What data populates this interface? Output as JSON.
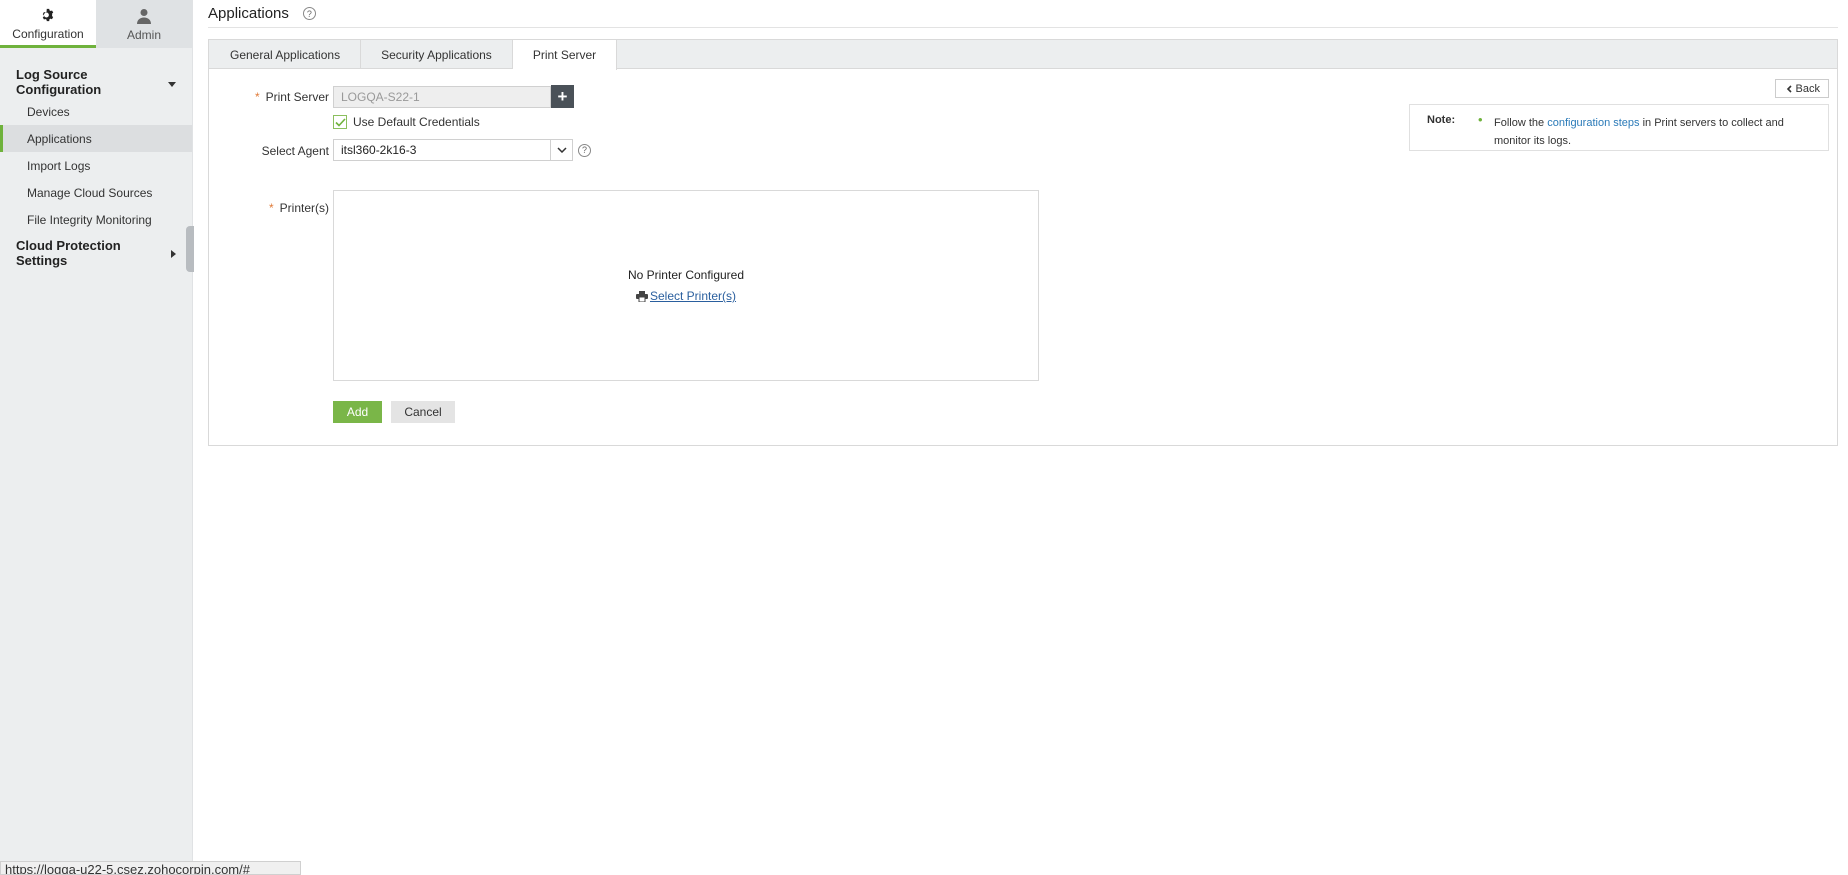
{
  "sidebar": {
    "top_tabs": [
      {
        "label": "Configuration",
        "icon": "gear-icon"
      },
      {
        "label": "Admin",
        "icon": "user-icon"
      }
    ],
    "groups": [
      {
        "label": "Log Source Configuration",
        "items": [
          "Devices",
          "Applications",
          "Import Logs",
          "Manage Cloud Sources",
          "File Integrity Monitoring"
        ]
      },
      {
        "label": "Cloud Protection Settings",
        "items": []
      }
    ],
    "active_item": "Applications"
  },
  "header": {
    "title": "Applications"
  },
  "tabs": [
    "General Applications",
    "Security Applications",
    "Print Server"
  ],
  "active_tab": "Print Server",
  "form": {
    "print_server_label": "Print Server",
    "print_server_value": "LOGQA-S22-1",
    "use_default_credentials_label": "Use Default Credentials",
    "use_default_credentials_checked": true,
    "select_agent_label": "Select Agent",
    "select_agent_value": "itsl360-2k16-3",
    "printers_label": "Printer(s)",
    "no_printer_msg": "No Printer Configured",
    "select_printers_link": "Select Printer(s)",
    "add_button": "Add",
    "cancel_button": "Cancel",
    "required_marker": "*"
  },
  "back_button": "Back",
  "note": {
    "label": "Note:",
    "text_before": "Follow the ",
    "link": "configuration steps",
    "text_after": " in Print servers to collect and monitor its logs."
  },
  "status_bar": "https://logqa-u22-5.csez.zohocorpin.com/#",
  "colors": {
    "accent": "#6fb23c",
    "button_primary": "#7ab648",
    "link": "#2a7ab8",
    "required": "#e07b39"
  }
}
